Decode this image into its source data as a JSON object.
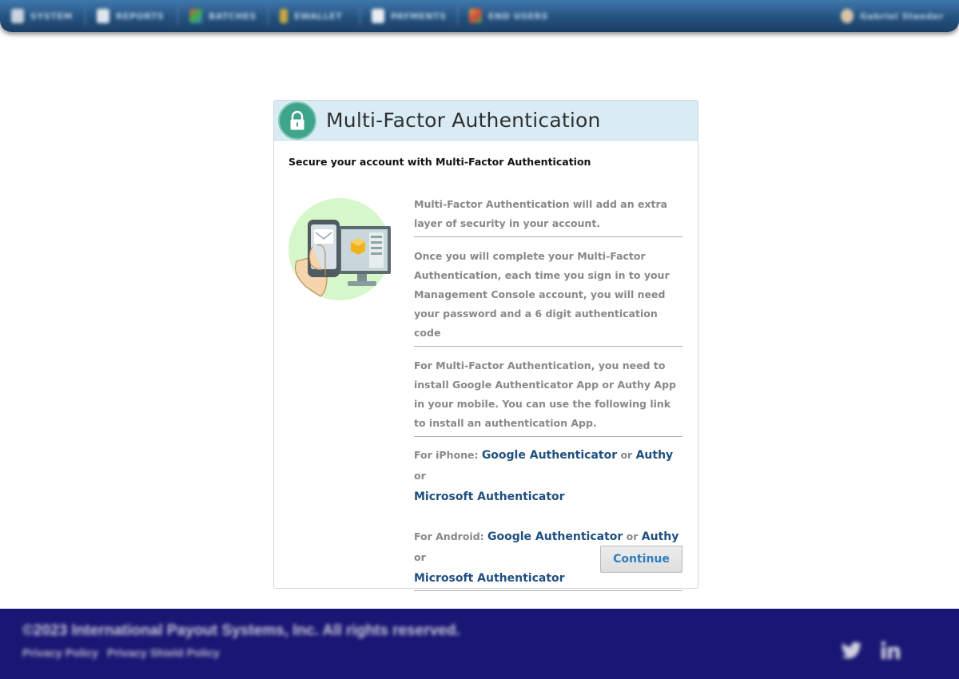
{
  "topnav": {
    "items": [
      {
        "label": "SYSTEM",
        "icon": "system-icon"
      },
      {
        "label": "REPORTS",
        "icon": "reports-icon"
      },
      {
        "label": "BATCHES",
        "icon": "batches-icon"
      },
      {
        "label": "EWALLET",
        "icon": "ewallet-icon"
      },
      {
        "label": "PAYMENTS",
        "icon": "payments-icon"
      },
      {
        "label": "END USERS",
        "icon": "end-users-icon"
      }
    ],
    "user": {
      "label": "Gabriel Staeder",
      "icon": "user-avatar-icon"
    }
  },
  "mfa": {
    "title": "Multi-Factor Authentication",
    "subtitle": "Secure your account with Multi-Factor Authentication",
    "paragraphs": [
      "Multi-Factor Authentication will add an extra layer of security in your account.",
      "Once you will complete your Multi-Factor Authentication, each time you sign in to your Management Console account, you will need your password and a 6 digit authentication code",
      "For Multi-Factor Authentication, you need to install Google Authenticator App or Authy App in your mobile. You can use the following link to install an authentication App."
    ],
    "iphone": {
      "prefix": "For iPhone:",
      "google": "Google Authenticator",
      "or1": "or",
      "authy": "Authy",
      "or2": "or",
      "microsoft": "Microsoft Authenticator"
    },
    "android": {
      "prefix": "For Android:",
      "google": "Google Authenticator",
      "or1": "or",
      "authy": "Authy",
      "or2": "or",
      "microsoft": "Microsoft Authenticator"
    },
    "continue_label": "Continue"
  },
  "footer": {
    "copyright": "©2023 International Payout Systems, Inc. All rights reserved.",
    "links": [
      "Privacy Policy",
      "Privacy Shield Policy"
    ],
    "social": [
      "twitter-icon",
      "linkedin-icon"
    ]
  },
  "colors": {
    "nav": "#23527f",
    "header_bg": "#d9ecf5",
    "lock_badge": "#3fa58a",
    "link": "#1f4f7f",
    "button_text": "#2e7fbf",
    "footer_bg": "#1a1774"
  }
}
